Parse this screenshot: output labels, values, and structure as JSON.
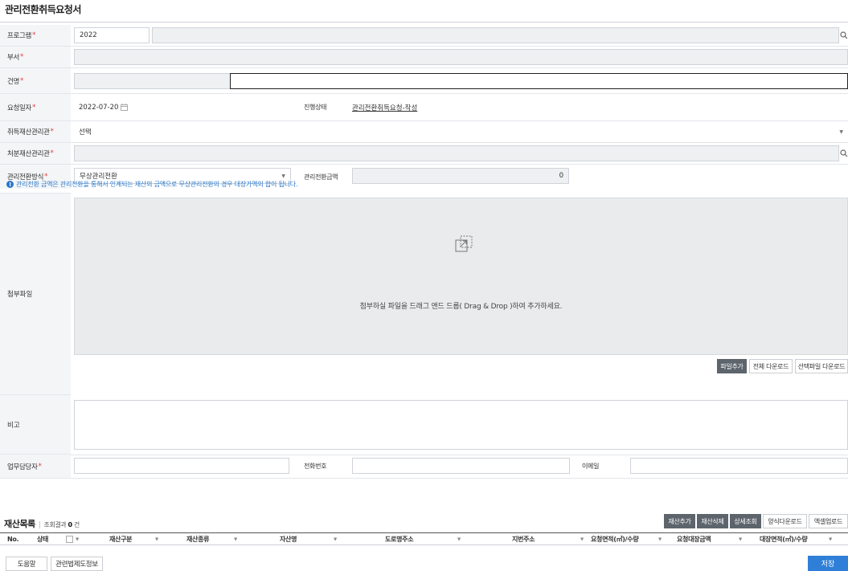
{
  "page": {
    "title": "관리전환취득요청서"
  },
  "form": {
    "program": {
      "label": "프로그램",
      "value": "2022",
      "name_value": ""
    },
    "dept": {
      "label": "부서",
      "value": ""
    },
    "subject": {
      "label": "건명",
      "value": ""
    },
    "request_date": {
      "label": "요청일자",
      "value": "2022-07-20"
    },
    "progress": {
      "label": "진행상태",
      "value": "관리전환취득요청-작성"
    },
    "acquire_manager": {
      "label": "취득재산관리관",
      "value": "선택"
    },
    "dispose_manager": {
      "label": "처분재산관리관",
      "value": ""
    },
    "transfer_method": {
      "label": "관리전환방식",
      "value": "무상관리전환"
    },
    "transfer_amount": {
      "label": "관리전환금액",
      "value": "0"
    },
    "notice": "관리전환 금액은 관리전환을 통해서 인계되는 재산의 금액으로 무상관리전환의 경우 대장가액의 합이 됩니다.",
    "attachment": {
      "label": "첨부파일",
      "drop_text": "첨부하실 파일을 드래그 앤드 드롭( Drag & Drop )하여 추가하세요.",
      "buttons": {
        "add": "파일추가",
        "download_all": "전체 다운로드",
        "download_selected": "선택파일 다운로드"
      }
    },
    "remarks": {
      "label": "비고",
      "value": ""
    },
    "manager": {
      "label": "업무담당자",
      "value": ""
    },
    "phone": {
      "label": "전화번호",
      "value": ""
    },
    "email": {
      "label": "이메일",
      "value": ""
    }
  },
  "asset_list": {
    "title": "재산목록",
    "result_label": "조회결과",
    "result_count": "0",
    "result_unit": "건",
    "buttons": {
      "add": "재산추가",
      "delete": "재산삭제",
      "detail": "상세조회",
      "form_download": "양식다운로드",
      "excel_upload": "엑셀업로드"
    },
    "columns": [
      "No.",
      "상태",
      "재산구분",
      "재산종류",
      "자산명",
      "도로명주소",
      "지번주소",
      "요청면적(㎡)/수량",
      "요청대장금액",
      "대장면적(㎡)/수량"
    ]
  },
  "footer": {
    "help": "도움말",
    "law_info": "관련법제도정보",
    "save": "저장"
  },
  "colors": {
    "required": "#e53b3b",
    "notice": "#2b78c8",
    "primary": "#2f7fd8",
    "dark_button": "#5d646c"
  }
}
